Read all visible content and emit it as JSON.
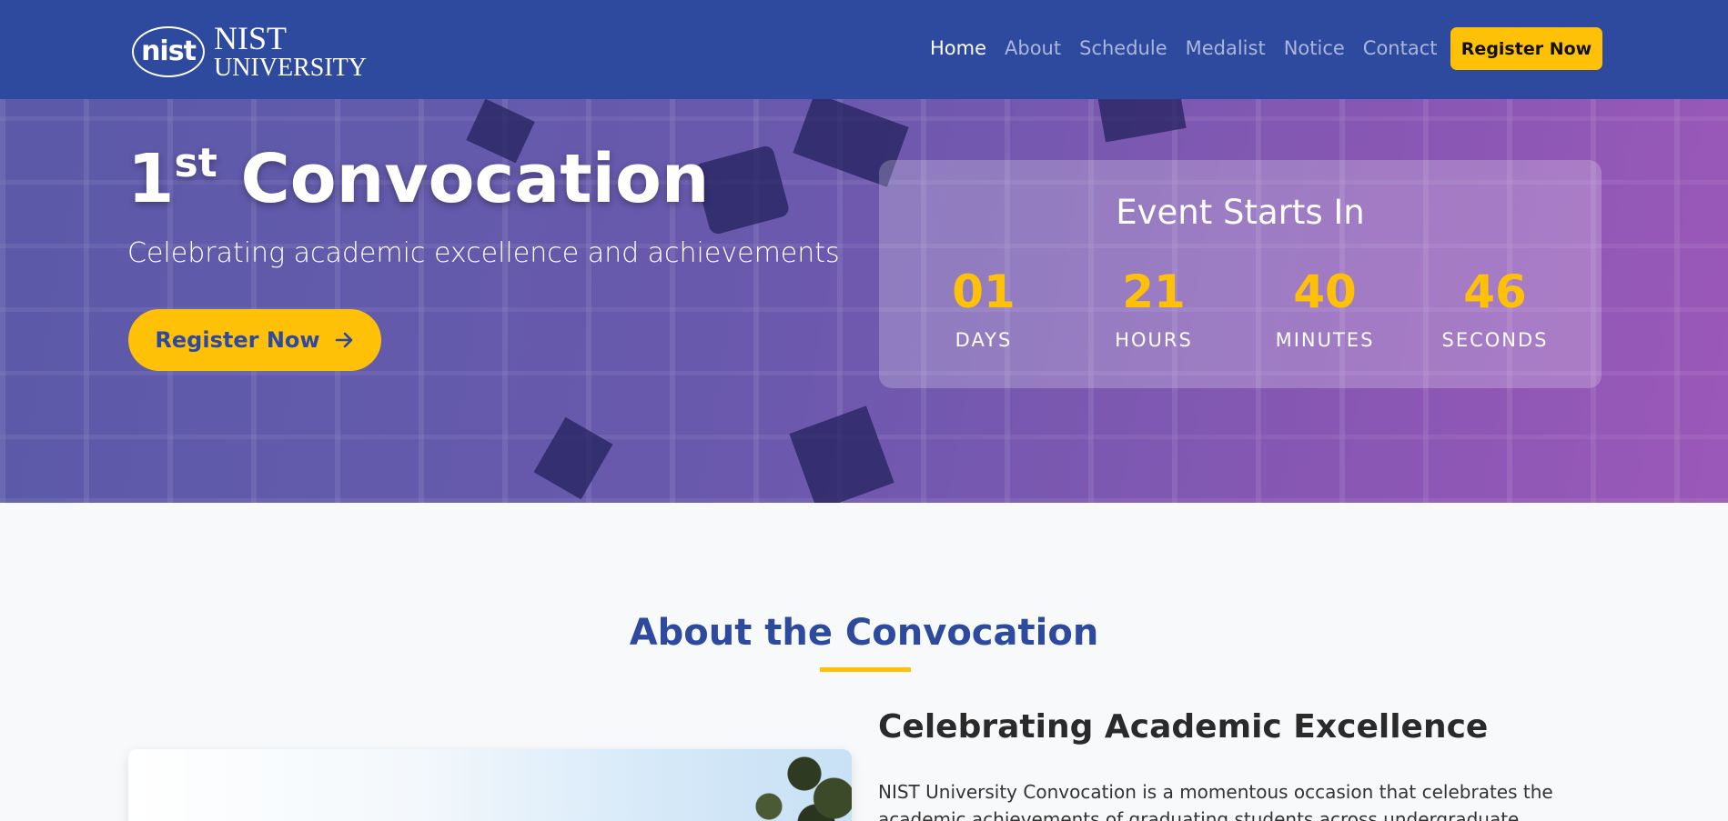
{
  "brand": {
    "emblem_text": "nist",
    "name_line1": "NIST",
    "name_line2": "UNIVERSITY"
  },
  "nav": {
    "items": [
      {
        "label": "Home",
        "active": true
      },
      {
        "label": "About",
        "active": false
      },
      {
        "label": "Schedule",
        "active": false
      },
      {
        "label": "Medalist",
        "active": false
      },
      {
        "label": "Notice",
        "active": false
      },
      {
        "label": "Contact",
        "active": false
      }
    ],
    "cta_label": "Register Now"
  },
  "hero": {
    "title_number": "1",
    "title_suffix": "st",
    "title_word": "Convocation",
    "subtitle": "Celebrating academic excellence and achievements",
    "cta_label": "Register Now",
    "cta_icon": "arrow-right-icon"
  },
  "countdown": {
    "title": "Event Starts In",
    "units": [
      {
        "value": "01",
        "label": "DAYS"
      },
      {
        "value": "21",
        "label": "HOURS"
      },
      {
        "value": "40",
        "label": "MINUTES"
      },
      {
        "value": "46",
        "label": "SECONDS"
      }
    ]
  },
  "about": {
    "heading": "About the Convocation",
    "subheading": "Celebrating Academic Excellence",
    "paragraph": "NIST University Convocation is a momentous occasion that celebrates the academic achievements of graduating students across undergraduate,"
  },
  "colors": {
    "navbar": "#2d4a9e",
    "accent": "#ffc107",
    "hero_overlay_start": "#5b5aa8",
    "hero_overlay_end": "#9b58b8"
  }
}
